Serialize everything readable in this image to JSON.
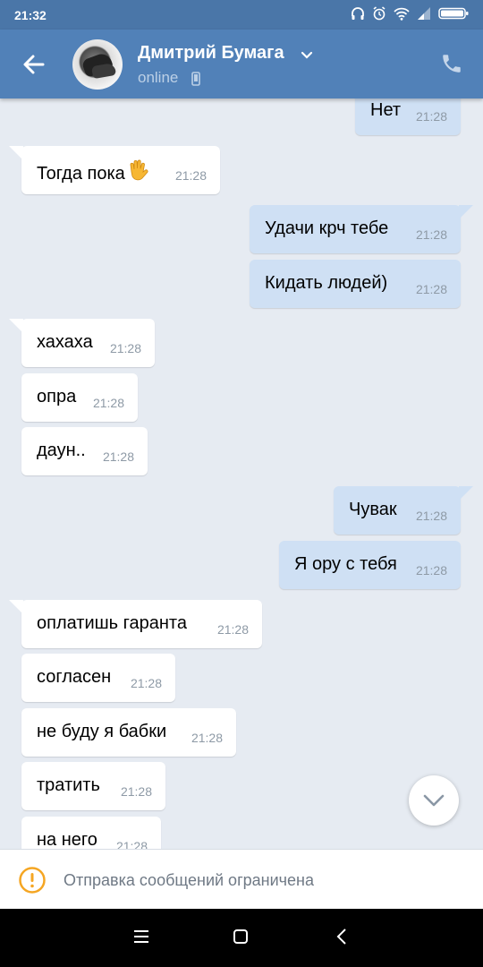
{
  "status_bar": {
    "time": "21:32",
    "icons": [
      "headphones-icon",
      "alarm-icon",
      "wifi-icon",
      "signal-icon",
      "battery-icon"
    ]
  },
  "header": {
    "contact_name": "Дмитрий Бумага",
    "status": "online",
    "icons": [
      "back-arrow-icon",
      "avatar",
      "chevron-down-icon",
      "mobile-device-icon",
      "phone-icon"
    ]
  },
  "messages": [
    {
      "side": "out",
      "text": "Нет",
      "time": "21:28"
    },
    {
      "side": "in",
      "text": "Тогда пока",
      "emoji": "waving-hand-icon",
      "time": "21:28"
    },
    {
      "side": "out",
      "text": "Удачи крч тебе",
      "time": "21:28"
    },
    {
      "side": "out",
      "text": "Кидать людей)",
      "time": "21:28"
    },
    {
      "side": "in",
      "text": "хахаха",
      "time": "21:28"
    },
    {
      "side": "in",
      "text": "опра",
      "time": "21:28"
    },
    {
      "side": "in",
      "text": "даун..",
      "time": "21:28"
    },
    {
      "side": "out",
      "text": "Чувак",
      "time": "21:28"
    },
    {
      "side": "out",
      "text": "Я ору с тебя",
      "time": "21:28"
    },
    {
      "side": "in",
      "text": "оплатишь гаранта",
      "time": "21:28"
    },
    {
      "side": "in",
      "text": "согласен",
      "time": "21:28"
    },
    {
      "side": "in",
      "text": "не буду я бабки",
      "time": "21:28"
    },
    {
      "side": "in",
      "text": "тратить",
      "time": "21:28"
    },
    {
      "side": "in",
      "text": "на него",
      "time": "21:28"
    }
  ],
  "restriction": {
    "text": "Отправка сообщений ограничена"
  },
  "nav_bar": {
    "buttons": [
      "menu-icon",
      "home-icon",
      "back-icon"
    ]
  },
  "colors": {
    "header": "#5181b8",
    "status_bar": "#4a76a8",
    "chat_background": "#e6ebf2",
    "incoming_bubble": "#ffffff",
    "outgoing_bubble": "#cfe0f4",
    "warning": "#f5a623"
  }
}
